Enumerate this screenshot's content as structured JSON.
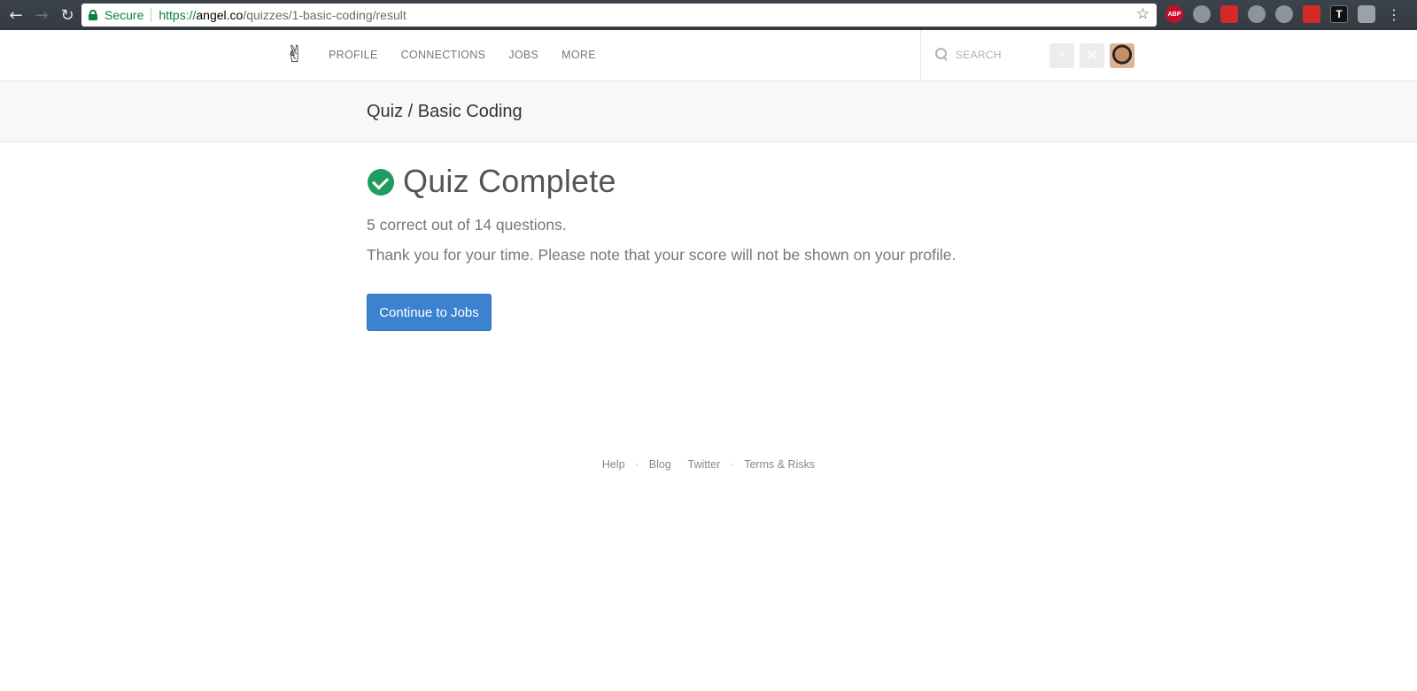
{
  "browser": {
    "secure_label": "Secure",
    "url_scheme": "https://",
    "url_host": "angel.co",
    "url_path": "/quizzes/1-basic-coding/result",
    "extensions": [
      "ABP",
      "",
      "",
      "",
      "",
      "",
      "T",
      ""
    ]
  },
  "header": {
    "nav": [
      "PROFILE",
      "CONNECTIONS",
      "JOBS",
      "MORE"
    ],
    "search_placeholder": "SEARCH"
  },
  "subheader": {
    "title": "Quiz / Basic Coding"
  },
  "main": {
    "title": "Quiz Complete",
    "score": "5 correct out of 14 questions.",
    "note": "Thank you for your time. Please note that your score will not be shown on your profile.",
    "continue_label": "Continue to Jobs"
  },
  "footer": {
    "help": "Help",
    "blog": "Blog",
    "twitter": "Twitter",
    "terms": "Terms & Risks",
    "separator": "·"
  },
  "colors": {
    "accent_button": "#3d82cf",
    "success": "#1f9c5f"
  }
}
